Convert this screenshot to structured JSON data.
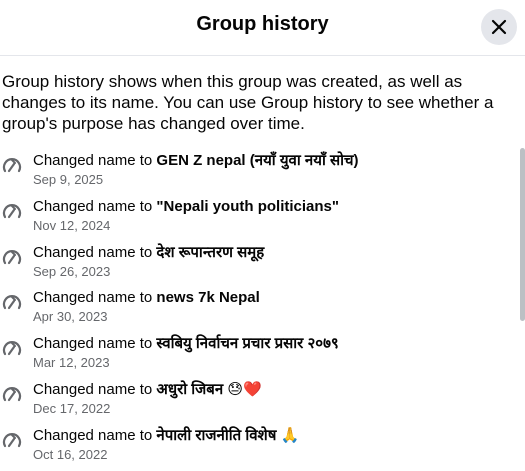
{
  "header": {
    "title": "Group history",
    "close_icon": "close-icon"
  },
  "intro": "Group history shows when this group was created, as well as changes to its name. You can use Group history to see whether a group's purpose has changed over time.",
  "history": [
    {
      "prefix": "Changed name to ",
      "name": "GEN Z nepal (नयाँ युवा नयाँ सोच)",
      "date": "Sep 9, 2025"
    },
    {
      "prefix": "Changed name to ",
      "name": "\"Nepali youth politicians\"",
      "date": "Nov 12, 2024"
    },
    {
      "prefix": "Changed name to ",
      "name": "देश रूपान्तरण समूह",
      "date": "Sep 26, 2023"
    },
    {
      "prefix": "Changed name to ",
      "name": "news 7k Nepal",
      "date": "Apr 30, 2023"
    },
    {
      "prefix": "Changed name to ",
      "name": "स्वबियु निर्वाचन प्रचार प्रसार २०७९",
      "date": "Mar 12, 2023"
    },
    {
      "prefix": "Changed name to ",
      "name": "अधुरो जिबन 😓❤️",
      "date": "Dec 17, 2022"
    },
    {
      "prefix": "Changed name to ",
      "name": "नेपाली राजनीति विशेष 🙏",
      "date": "Oct 16, 2022"
    }
  ],
  "colors": {
    "text": "#050505",
    "secondary": "#65676b",
    "button_bg": "#e4e6eb",
    "icon": "#65676b"
  }
}
